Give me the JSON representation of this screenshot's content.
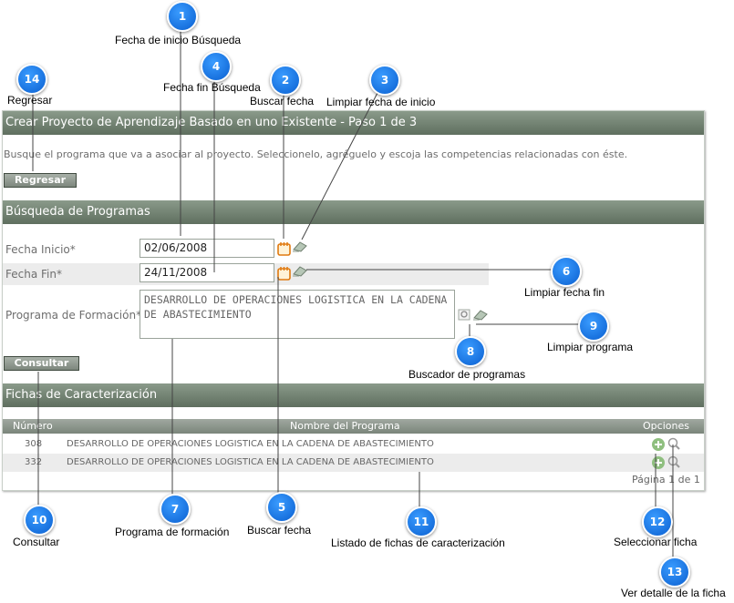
{
  "panel": {
    "title": "Crear Proyecto de Aprendizaje Basado en uno Existente - Paso 1 de 3",
    "instructions": "Busque el programa que va a asociar al proyecto. Seleccionelo, agréguelo y escoja las competencias relacionadas con éste.",
    "back_button": "Regresar",
    "search_section_title": "Búsqueda de Programas",
    "fields": {
      "start_label": "Fecha Inicio*",
      "start_value": "02/06/2008",
      "end_label": "Fecha Fin*",
      "end_value": "24/11/2008",
      "program_label": "Programa de Formación*",
      "program_value": "DESARROLLO DE OPERACIONES LOGISTICA EN LA CADENA DE ABASTECIMIENTO"
    },
    "query_button": "Consultar",
    "results_section_title": "Fichas de Caracterización",
    "table": {
      "headers": [
        "Número",
        "Nombre del Programa",
        "Opciones"
      ],
      "rows": [
        {
          "number": "308",
          "name": "DESARROLLO DE OPERACIONES LOGISTICA EN LA CADENA DE ABASTECIMIENTO"
        },
        {
          "number": "332",
          "name": "DESARROLLO DE OPERACIONES LOGISTICA EN LA CADENA DE ABASTECIMIENTO"
        }
      ],
      "pagination": "Página 1 de 1"
    }
  },
  "callouts": [
    {
      "n": "1",
      "label": "Fecha de inicio Búsqueda"
    },
    {
      "n": "2",
      "label": "Buscar fecha"
    },
    {
      "n": "3",
      "label": "Limpiar fecha de inicio"
    },
    {
      "n": "4",
      "label": "Fecha fin Búsqueda"
    },
    {
      "n": "5",
      "label": "Buscar fecha"
    },
    {
      "n": "6",
      "label": "Limpiar fecha fin"
    },
    {
      "n": "7",
      "label": "Programa de formación"
    },
    {
      "n": "8",
      "label": "Buscador de programas"
    },
    {
      "n": "9",
      "label": "Limpiar programa"
    },
    {
      "n": "10",
      "label": "Consultar"
    },
    {
      "n": "11",
      "label": "Listado de fichas de caracterización"
    },
    {
      "n": "12",
      "label": "Seleccionar ficha"
    },
    {
      "n": "13",
      "label": "Ver detalle de la ficha"
    },
    {
      "n": "14",
      "label": "Regresar"
    }
  ],
  "colors": {
    "callout": "#1a7af0",
    "bar": "#6f7f6f",
    "add_icon": "#8fbf7f"
  }
}
